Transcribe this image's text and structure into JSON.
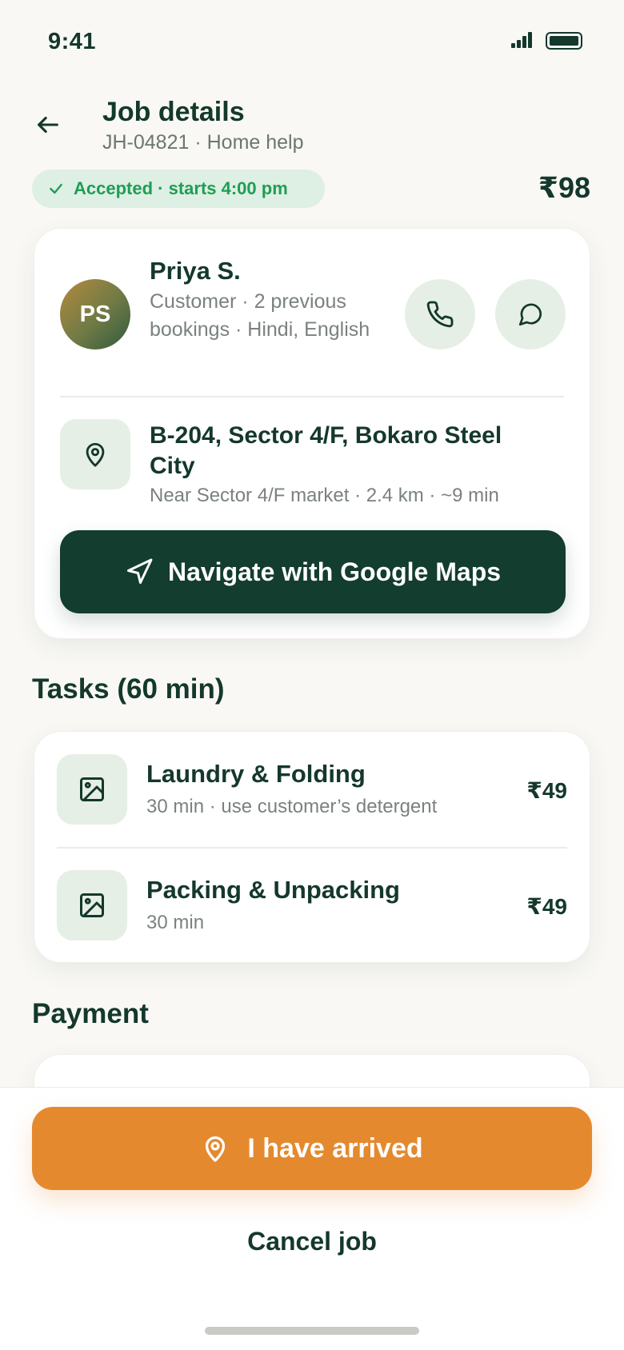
{
  "status_bar": {
    "time": "9:41"
  },
  "header": {
    "title": "Job details",
    "subtitle": "JH-04821 · Home help",
    "status": "Accepted · starts 4:00 pm",
    "total_price": "₹98"
  },
  "customer": {
    "initials": "PS",
    "name": "Priya S.",
    "meta": "Customer · 2 previous bookings · Hindi, English"
  },
  "address": {
    "line": "B-204, Sector 4/F, Bokaro Steel City",
    "detail": "Near Sector 4/F market · 2.4 km · ~9 min"
  },
  "navigate_label": "Navigate with Google Maps",
  "tasks": {
    "title": "Tasks (60 min)",
    "items": [
      {
        "name": "Laundry & Folding",
        "meta": "30 min · use customer’s detergent",
        "price": "₹49"
      },
      {
        "name": "Packing & Unpacking",
        "meta": "30 min",
        "price": "₹49"
      }
    ]
  },
  "payment": {
    "title": "Payment"
  },
  "actions": {
    "arrived_label": "I have arrived",
    "cancel_label": "Cancel job"
  },
  "colors": {
    "primary_dark": "#133d2e",
    "accent_orange": "#e5892e",
    "success_green": "#1f9d55",
    "success_bg": "#deefe3",
    "icon_bg": "#e6efe5"
  },
  "icons": {
    "back": "arrow-left-icon",
    "status_check": "check-icon",
    "call": "phone-icon",
    "chat": "chat-bubble-icon",
    "location": "map-pin-icon",
    "navigate": "navigation-arrow-icon",
    "task_thumb": "image-icon",
    "arrived": "map-pin-icon"
  }
}
